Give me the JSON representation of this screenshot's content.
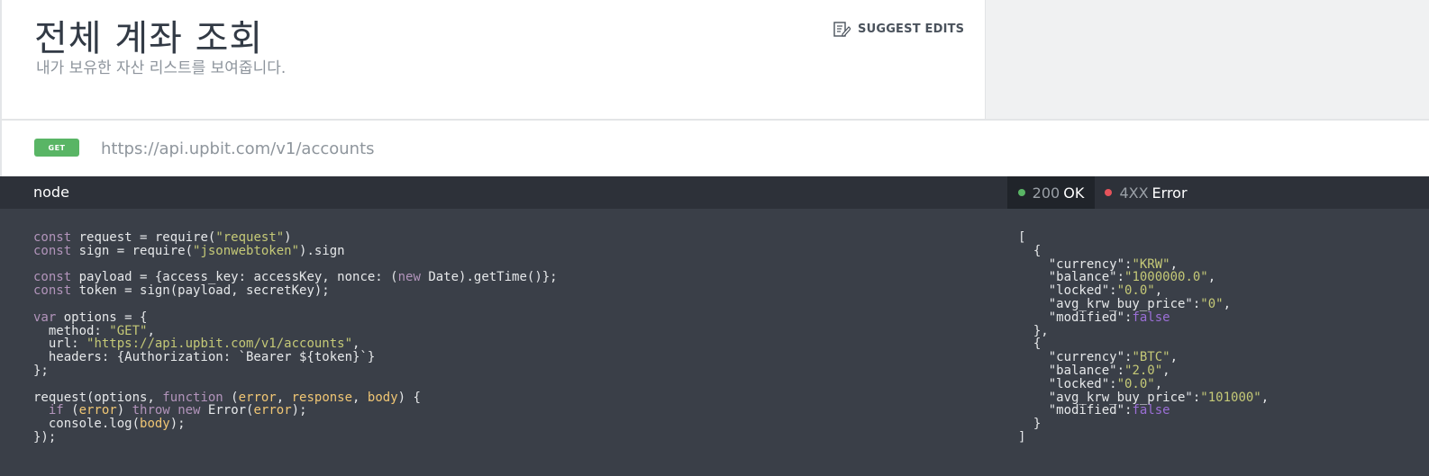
{
  "header": {
    "title": "전체 계좌 조회",
    "subtitle": "내가 보유한 자산 리스트를 보여줍니다.",
    "suggest_label": "SUGGEST EDITS"
  },
  "endpoint": {
    "method": "GET",
    "url": "https://api.upbit.com/v1/accounts"
  },
  "code_panel": {
    "language_tab": "node",
    "lines": [
      [
        {
          "t": "const",
          "c": "kw"
        },
        {
          "t": " request = require(",
          "c": ""
        },
        {
          "t": "\"request\"",
          "c": "str"
        },
        {
          "t": ")",
          "c": ""
        }
      ],
      [
        {
          "t": "const",
          "c": "kw"
        },
        {
          "t": " sign = require(",
          "c": ""
        },
        {
          "t": "\"jsonwebtoken\"",
          "c": "str"
        },
        {
          "t": ").sign",
          "c": ""
        }
      ],
      [],
      [
        {
          "t": "const",
          "c": "kw"
        },
        {
          "t": " payload = {access_key: accessKey, nonce: (",
          "c": ""
        },
        {
          "t": "new",
          "c": "kw"
        },
        {
          "t": " Date).getTime()};",
          "c": ""
        }
      ],
      [
        {
          "t": "const",
          "c": "kw"
        },
        {
          "t": " token = sign(payload, secretKey);",
          "c": ""
        }
      ],
      [],
      [
        {
          "t": "var",
          "c": "kw"
        },
        {
          "t": " options = {",
          "c": ""
        }
      ],
      [
        {
          "t": "  method: ",
          "c": ""
        },
        {
          "t": "\"GET\"",
          "c": "str"
        },
        {
          "t": ",",
          "c": ""
        }
      ],
      [
        {
          "t": "  url: ",
          "c": ""
        },
        {
          "t": "\"https://api.upbit.com/v1/accounts\"",
          "c": "str"
        },
        {
          "t": ",",
          "c": ""
        }
      ],
      [
        {
          "t": "  headers: {Authorization: `Bearer ${token}`}",
          "c": ""
        }
      ],
      [
        {
          "t": "};",
          "c": ""
        }
      ],
      [],
      [
        {
          "t": "request(options, ",
          "c": ""
        },
        {
          "t": "function",
          "c": "kw"
        },
        {
          "t": " (",
          "c": ""
        },
        {
          "t": "error",
          "c": "var"
        },
        {
          "t": ", ",
          "c": ""
        },
        {
          "t": "response",
          "c": "var"
        },
        {
          "t": ", ",
          "c": ""
        },
        {
          "t": "body",
          "c": "var"
        },
        {
          "t": ") {",
          "c": ""
        }
      ],
      [
        {
          "t": "  ",
          "c": ""
        },
        {
          "t": "if",
          "c": "kw"
        },
        {
          "t": " (",
          "c": ""
        },
        {
          "t": "error",
          "c": "var"
        },
        {
          "t": ") ",
          "c": ""
        },
        {
          "t": "throw",
          "c": "kw"
        },
        {
          "t": " ",
          "c": ""
        },
        {
          "t": "new",
          "c": "kw"
        },
        {
          "t": " Error(",
          "c": ""
        },
        {
          "t": "error",
          "c": "var"
        },
        {
          "t": ");",
          "c": ""
        }
      ],
      [
        {
          "t": "  console.log(",
          "c": ""
        },
        {
          "t": "body",
          "c": "var"
        },
        {
          "t": ");",
          "c": ""
        }
      ],
      [
        {
          "t": "});",
          "c": ""
        }
      ]
    ]
  },
  "response_panel": {
    "tabs": [
      {
        "code": "200",
        "label": "OK",
        "dot_color": "#59b565",
        "active": true
      },
      {
        "code": "4XX",
        "label": "Error",
        "dot_color": "#e5535b",
        "active": false
      }
    ],
    "lines": [
      [
        {
          "t": "[",
          "c": ""
        }
      ],
      [
        {
          "t": "  {",
          "c": ""
        }
      ],
      [
        {
          "t": "    \"currency\":",
          "c": ""
        },
        {
          "t": "\"KRW\"",
          "c": "str"
        },
        {
          "t": ",",
          "c": ""
        }
      ],
      [
        {
          "t": "    \"balance\":",
          "c": ""
        },
        {
          "t": "\"1000000.0\"",
          "c": "str"
        },
        {
          "t": ",",
          "c": ""
        }
      ],
      [
        {
          "t": "    \"locked\":",
          "c": ""
        },
        {
          "t": "\"0.0\"",
          "c": "str"
        },
        {
          "t": ",",
          "c": ""
        }
      ],
      [
        {
          "t": "    \"avg_krw_buy_price\":",
          "c": ""
        },
        {
          "t": "\"0\"",
          "c": "str"
        },
        {
          "t": ",",
          "c": ""
        }
      ],
      [
        {
          "t": "    \"modified\":",
          "c": ""
        },
        {
          "t": "false",
          "c": "bool"
        }
      ],
      [
        {
          "t": "  },",
          "c": ""
        }
      ],
      [
        {
          "t": "  {",
          "c": ""
        }
      ],
      [
        {
          "t": "    \"currency\":",
          "c": ""
        },
        {
          "t": "\"BTC\"",
          "c": "str"
        },
        {
          "t": ",",
          "c": ""
        }
      ],
      [
        {
          "t": "    \"balance\":",
          "c": ""
        },
        {
          "t": "\"2.0\"",
          "c": "str"
        },
        {
          "t": ",",
          "c": ""
        }
      ],
      [
        {
          "t": "    \"locked\":",
          "c": ""
        },
        {
          "t": "\"0.0\"",
          "c": "str"
        },
        {
          "t": ",",
          "c": ""
        }
      ],
      [
        {
          "t": "    \"avg_krw_buy_price\":",
          "c": ""
        },
        {
          "t": "\"101000\"",
          "c": "str"
        },
        {
          "t": ",",
          "c": ""
        }
      ],
      [
        {
          "t": "    \"modified\":",
          "c": ""
        },
        {
          "t": "false",
          "c": "bool"
        }
      ],
      [
        {
          "t": "  }",
          "c": ""
        }
      ],
      [
        {
          "t": "]",
          "c": ""
        }
      ]
    ]
  },
  "colors": {
    "get_badge": "#59b565",
    "code_bg": "#3a3f48",
    "tabbar_bg": "#2d3139",
    "string": "#c5c977",
    "keyword": "#b294bb",
    "variable": "#f0c674",
    "boolean": "#9b6fd6"
  },
  "icons": {
    "suggest": "edit-document-icon"
  }
}
